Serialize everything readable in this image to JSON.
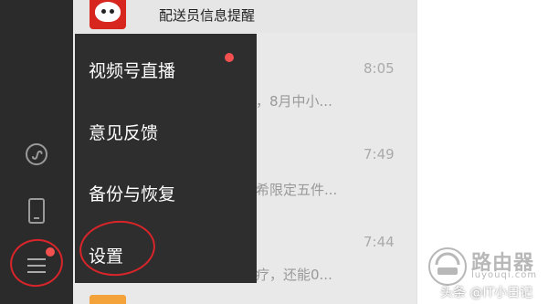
{
  "sidebar": {
    "icons": [
      "mini-program-icon",
      "phone-icon",
      "menu-icon"
    ],
    "badge_color": "#f35150"
  },
  "chat_list": {
    "top_item": {
      "title": "配送员信息提醒"
    },
    "items": [
      {
        "time": "8:05",
        "preview": "，8月中小..."
      },
      {
        "time": "7:49",
        "preview": "希限定五件..."
      },
      {
        "time": "7:44",
        "preview": "疗，还能0..."
      }
    ]
  },
  "popup_menu": {
    "items": [
      {
        "label": "视频号直播",
        "has_dot": true
      },
      {
        "label": "意见反馈"
      },
      {
        "label": "备份与恢复"
      },
      {
        "label": "设置",
        "highlighted": true
      }
    ],
    "dot_color": "#f35150",
    "highlight_color": "#d9252a"
  },
  "watermark": {
    "router_name": "路由器",
    "router_url": "luyouqi.com",
    "source": "头条 @IT小日记"
  }
}
